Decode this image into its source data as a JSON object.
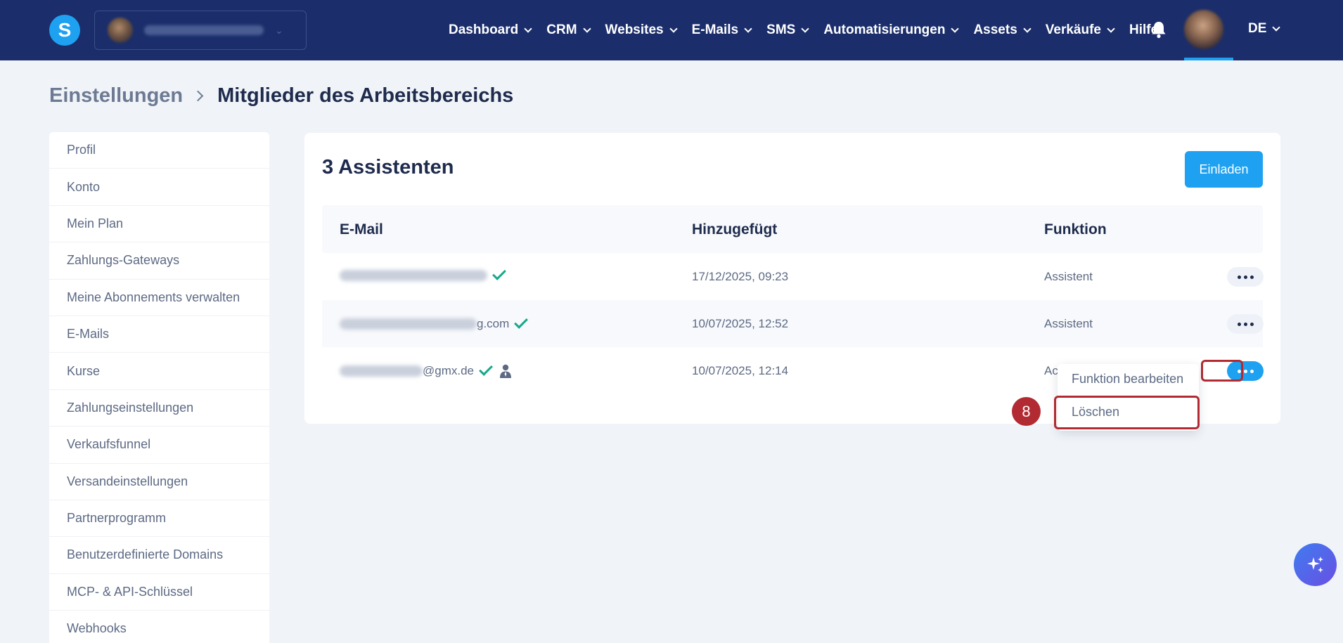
{
  "brand": {
    "logo_letter": "S"
  },
  "nav": {
    "items": [
      "Dashboard",
      "CRM",
      "Websites",
      "E-Mails",
      "SMS",
      "Automatisierungen",
      "Assets",
      "Verkäufe"
    ],
    "help": "Hilfe",
    "language": "DE"
  },
  "breadcrumb": {
    "root": "Einstellungen",
    "current": "Mitglieder des Arbeitsbereichs"
  },
  "sidebar": {
    "items": [
      "Profil",
      "Konto",
      "Mein Plan",
      "Zahlungs-Gateways",
      "Meine Abonnements verwalten",
      "E-Mails",
      "Kurse",
      "Zahlungseinstellungen",
      "Verkaufsfunnel",
      "Versandeinstellungen",
      "Partnerprogramm",
      "Benutzerdefinierte Domains",
      "MCP- & API-Schlüssel",
      "Webhooks"
    ]
  },
  "main": {
    "title": "3 Assistenten",
    "invite_label": "Einladen",
    "columns": {
      "email": "E-Mail",
      "added": "Hinzugefügt",
      "role": "Funktion"
    },
    "rows": [
      {
        "email_suffix": "",
        "added": "17/12/2025, 09:23",
        "role": "Assistent"
      },
      {
        "email_suffix": "g.com",
        "added": "10/07/2025, 12:52",
        "role": "Assistent"
      },
      {
        "email_suffix": "@gmx.de",
        "added": "10/07/2025, 12:14",
        "role": "Ac"
      }
    ]
  },
  "menu": {
    "edit_role": "Funktion bearbeiten",
    "delete": "Löschen"
  },
  "annotation": {
    "step": "8"
  },
  "colors": {
    "nav_bg": "#1b2e6b",
    "accent": "#1ea1f1",
    "highlight": "#b22b32",
    "verified": "#17a88a"
  }
}
